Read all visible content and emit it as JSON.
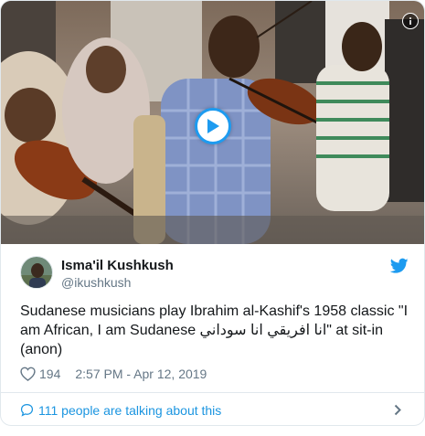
{
  "tweet": {
    "display_name": "Isma'il Kushkush",
    "handle": "@ikushkush",
    "text": "Sudanese musicians play Ibrahim al-Kashif's 1958 classic \"I am African, I am Sudanese انا افريقي انا سوداني\" at sit-in (anon)",
    "likes": "194",
    "timestamp": "2:57 PM - Apr 12, 2019",
    "conversation_label": "111 people are talking about this"
  },
  "icons": {
    "play": "play-icon",
    "info": "info-icon",
    "brand": "twitter-bird-icon",
    "like": "heart-icon",
    "reply": "speech-bubble-icon",
    "next": "chevron-right-icon"
  },
  "colors": {
    "accent": "#1d9bf0",
    "link": "#1b95e0",
    "muted": "#657786",
    "text": "#14171a",
    "border": "#e1e8ed"
  }
}
